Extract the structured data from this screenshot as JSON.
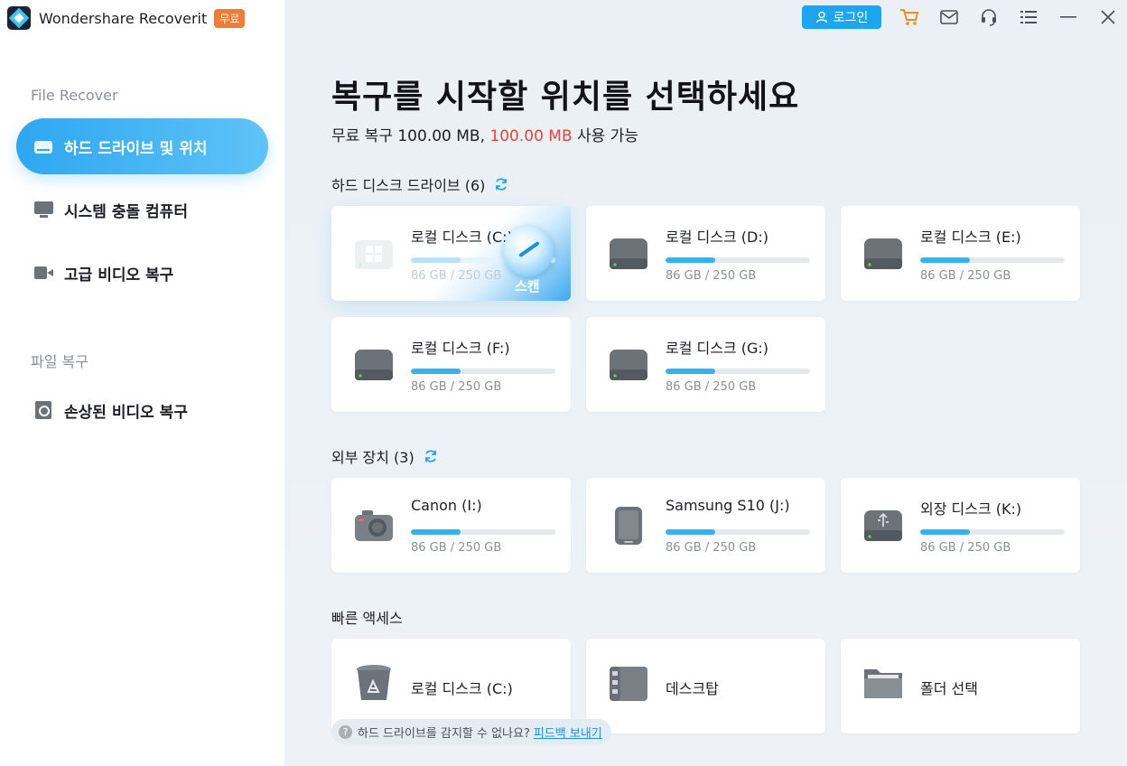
{
  "app": {
    "name": "Wondershare Recoverit",
    "badge": "무료"
  },
  "sidebar": {
    "section_file_recover": "File Recover",
    "items": [
      {
        "label": "하드 드라이브 및 위치",
        "icon": "hard-drive-icon",
        "active": true
      },
      {
        "label": "시스템 충돌 컴퓨터",
        "icon": "monitor-icon",
        "active": false
      },
      {
        "label": "고급 비디오 복구",
        "icon": "video-camera-icon",
        "active": false
      }
    ],
    "section_file_repair": "파일 복구",
    "repair_items": [
      {
        "label": "손상된 비디오 복구",
        "icon": "file-search-icon"
      }
    ]
  },
  "topbar": {
    "login_label": "로그인",
    "icons": [
      "cart-icon",
      "mail-icon",
      "headset-icon",
      "menu-icon",
      "minimize-icon",
      "close-icon"
    ]
  },
  "main": {
    "title": "복구를 시작할 위치를 선택하세요",
    "quota_prefix": "무료 복구 100.00 MB, ",
    "quota_highlight": "100.00 MB",
    "quota_suffix": " 사용 가능",
    "hard_disks": {
      "label": "하드 디스크 드라이브 (6)",
      "drives": [
        {
          "name": "로컬 디스크 (C:)",
          "size": "86 GB / 250 GB",
          "used_fraction": 0.344,
          "selected": true,
          "scan_label": "스캔",
          "icon": "windows-drive-icon"
        },
        {
          "name": "로컬 디스크 (D:)",
          "size": "86 GB / 250 GB",
          "used_fraction": 0.344,
          "icon": "hard-drive-icon"
        },
        {
          "name": "로컬 디스크 (E:)",
          "size": "86 GB / 250 GB",
          "used_fraction": 0.344,
          "icon": "hard-drive-icon"
        },
        {
          "name": "로컬 디스크 (F:)",
          "size": "86 GB / 250 GB",
          "used_fraction": 0.344,
          "icon": "hard-drive-icon"
        },
        {
          "name": "로컬 디스크 (G:)",
          "size": "86 GB / 250 GB",
          "used_fraction": 0.344,
          "icon": "hard-drive-icon"
        }
      ]
    },
    "external": {
      "label": "외부 장치 (3)",
      "devices": [
        {
          "name": "Canon (I:)",
          "size": "86 GB / 250 GB",
          "used_fraction": 0.344,
          "icon": "camera-icon"
        },
        {
          "name": "Samsung S10 (J:)",
          "size": "86 GB / 250 GB",
          "used_fraction": 0.344,
          "icon": "phone-icon"
        },
        {
          "name": "외장 디스크 (K:)",
          "size": "86 GB / 250 GB",
          "used_fraction": 0.344,
          "icon": "usb-drive-icon"
        }
      ]
    },
    "quick_access": {
      "label": "빠른 액세스",
      "items": [
        {
          "name": "로컬 디스크 (C:)",
          "icon": "recycle-bin-icon"
        },
        {
          "name": "데스크탑",
          "icon": "desktop-icon"
        },
        {
          "name": "폴더 선택",
          "icon": "folder-icon"
        }
      ]
    },
    "feedback": {
      "question": "하드 드라이브를 감지할 수 없나요?",
      "link": "피드백 보내기"
    }
  },
  "colors": {
    "accent": "#1da6ef",
    "badge": "#ef7b36",
    "highlight_red": "#e2453a"
  }
}
